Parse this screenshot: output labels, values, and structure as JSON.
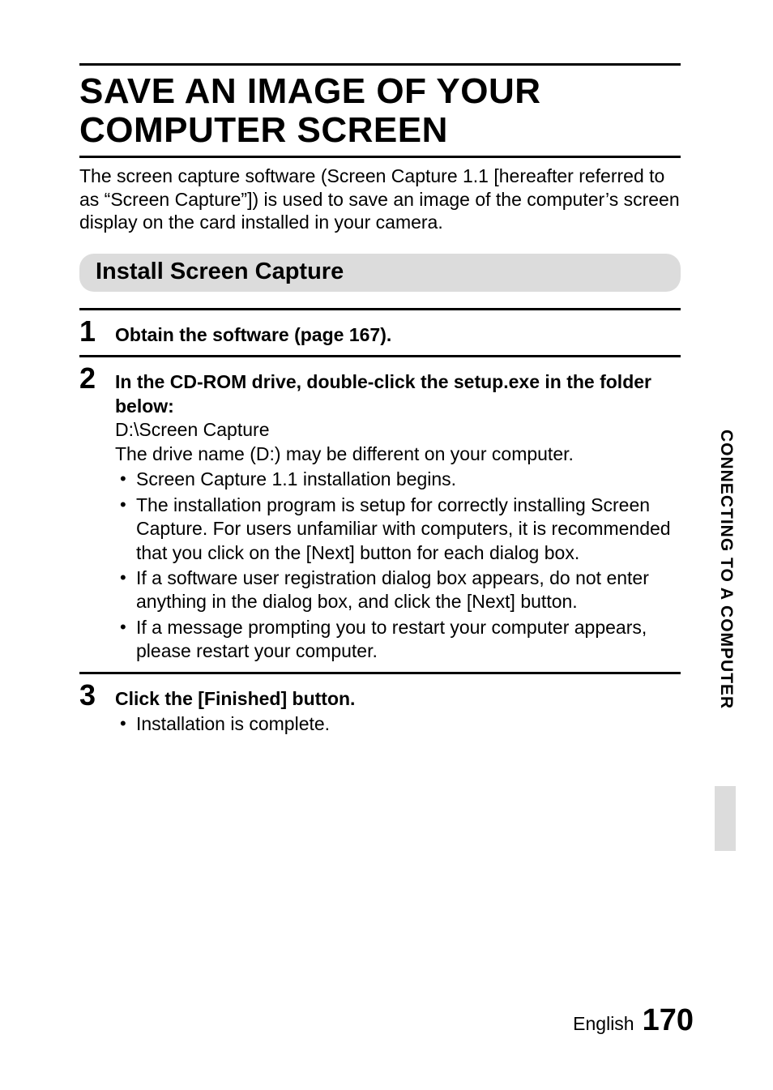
{
  "title": "SAVE AN IMAGE OF YOUR COMPUTER SCREEN",
  "intro": "The screen capture software (Screen Capture 1.1 [hereafter referred to as “Screen Capture”]) is used to save an image of the computer’s screen display on the card installed in your camera.",
  "section_heading": "Install Screen Capture",
  "steps": {
    "s1": {
      "num": "1",
      "head": "Obtain the software (page 167)."
    },
    "s2": {
      "num": "2",
      "head": "In the CD-ROM drive, double-click the setup.exe in the folder below:",
      "path": "D:\\Screen Capture",
      "note": "The drive name (D:) may be different on your computer.",
      "bullets": [
        "Screen Capture 1.1 installation begins.",
        "The installation program is setup for correctly installing Screen Capture. For users unfamiliar with computers, it is recommended that you click on the [Next] button for each dialog box.",
        "If a software user registration dialog box appears, do not enter anything in the dialog box, and click the [Next] button.",
        "If a message prompting you to restart your computer appears, please restart your computer."
      ]
    },
    "s3": {
      "num": "3",
      "head": "Click the [Finished] button.",
      "bullets": [
        "Installation is complete."
      ]
    }
  },
  "side_tab": "CONNECTING TO A COMPUTER",
  "footer": {
    "lang": "English",
    "page": "170"
  }
}
